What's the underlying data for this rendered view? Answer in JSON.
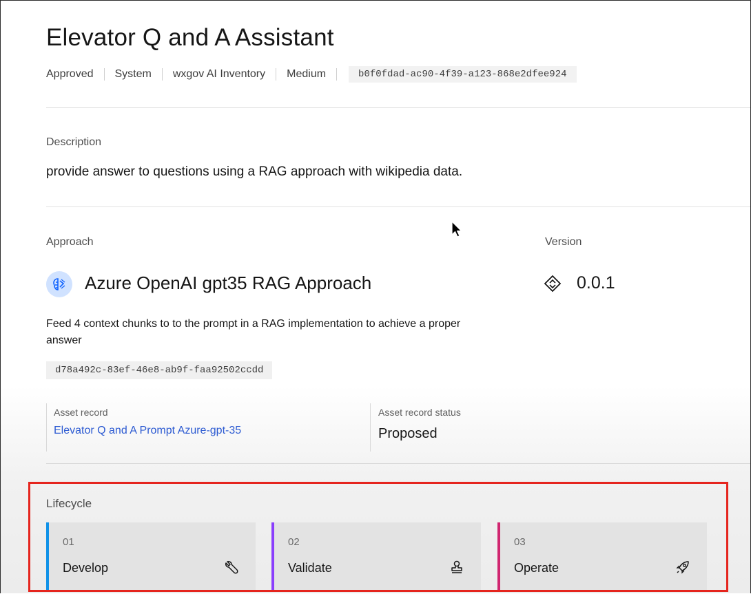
{
  "header": {
    "title": "Elevator Q and A Assistant",
    "meta": [
      "Approved",
      "System",
      "wxgov AI Inventory",
      "Medium"
    ],
    "id": "b0f0fdad-ac90-4f39-a123-868e2dfee924"
  },
  "description": {
    "label": "Description",
    "text": "provide answer to questions using a RAG approach with wikipedia data."
  },
  "approach": {
    "label": "Approach",
    "name": "Azure OpenAI gpt35 RAG Approach",
    "icon": "ai-model-icon",
    "description": "Feed 4 context chunks to to the prompt in a RAG implementation to achieve a proper answer",
    "id": "d78a492c-83ef-46e8-ab9f-faa92502ccdd"
  },
  "version": {
    "label": "Version",
    "value": "0.0.1",
    "icon": "version-diamond-icon"
  },
  "asset": {
    "record_label": "Asset record",
    "record_link": "Elevator Q and A Prompt Azure-gpt-35",
    "status_label": "Asset record status",
    "status": "Proposed"
  },
  "lifecycle": {
    "label": "Lifecycle",
    "stages": [
      {
        "num": "01",
        "name": "Develop",
        "icon": "wrench-icon",
        "color": "#1192e8"
      },
      {
        "num": "02",
        "name": "Validate",
        "icon": "stamp-icon",
        "color": "#8a3ffc"
      },
      {
        "num": "03",
        "name": "Operate",
        "icon": "rocket-icon",
        "color": "#d02670"
      }
    ]
  },
  "colors": {
    "link": "#2d5bd2",
    "highlight_box": "#e5251e"
  }
}
